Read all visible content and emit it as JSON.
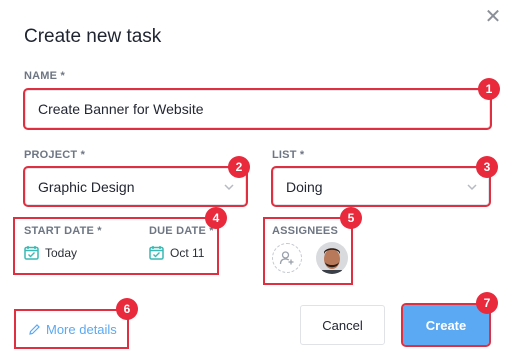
{
  "dialog": {
    "title": "Create new task",
    "close_icon": "close-icon"
  },
  "name": {
    "label": "NAME *",
    "value": "Create Banner for Website"
  },
  "project": {
    "label": "PROJECT *",
    "value": "Graphic Design"
  },
  "list": {
    "label": "LIST *",
    "value": "Doing"
  },
  "start_date": {
    "label": "START DATE *",
    "value": "Today"
  },
  "due_date": {
    "label": "DUE DATE *",
    "value": "Oct 11"
  },
  "assignees": {
    "label": "ASSIGNEES",
    "add_icon": "add-user-icon",
    "avatar": "avatar"
  },
  "more_details": {
    "label": "More details",
    "icon": "pencil-icon"
  },
  "buttons": {
    "cancel": "Cancel",
    "create": "Create"
  },
  "annotations": [
    "1",
    "2",
    "3",
    "4",
    "5",
    "6",
    "7"
  ],
  "colors": {
    "accent": "#5aa9f2",
    "highlight": "#e02f3e",
    "calendar": "#3bb9b4"
  }
}
